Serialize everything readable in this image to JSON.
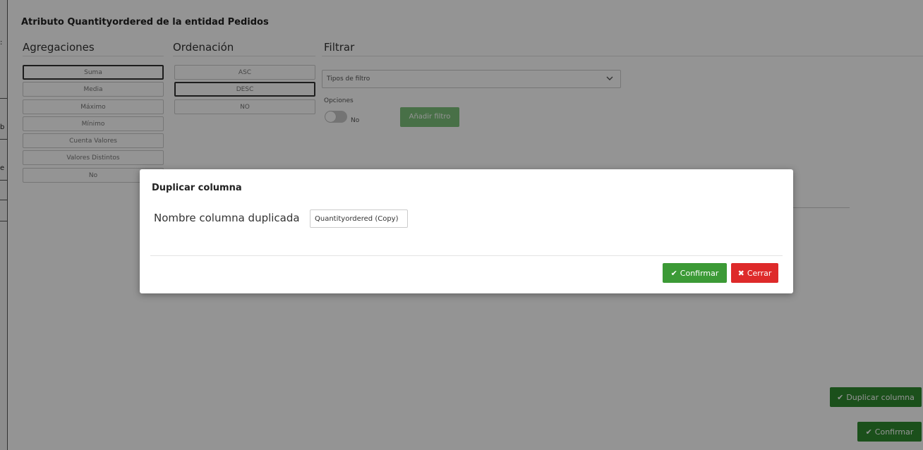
{
  "page": {
    "title": "Atributo Quantityordered de la entidad Pedidos"
  },
  "sections": {
    "agregaciones": "Agregaciones",
    "ordenacion": "Ordenación",
    "filtrar": "Filtrar"
  },
  "agregaciones": [
    "Suma",
    "Media",
    "Máximo",
    "Mínimo",
    "Cuenta Valores",
    "Valores Distintos",
    "No"
  ],
  "ordenacion": [
    "ASC",
    "DESC",
    "NO"
  ],
  "filtro": {
    "tipos_placeholder": "Tipos de filtro",
    "opciones_label": "Opciones",
    "toggle_value": "No",
    "add_button": "Añadir filtro"
  },
  "left_strip_chars": [
    ":",
    "b",
    "e"
  ],
  "buttons": {
    "duplicar_columna": "Duplicar columna",
    "confirmar": "Confirmar"
  },
  "modal": {
    "title": "Duplicar columna",
    "label": "Nombre columna duplicada",
    "input_value": "Quantityordered (Copy)",
    "confirm": "Confirmar",
    "close": "Cerrar"
  },
  "icons": {
    "check": "check-icon",
    "close": "times-icon",
    "chevron": "chevron-down-icon"
  },
  "colors": {
    "green": "#2f8a2f",
    "green_light": "#7cc27a",
    "red": "#de2a2a"
  }
}
